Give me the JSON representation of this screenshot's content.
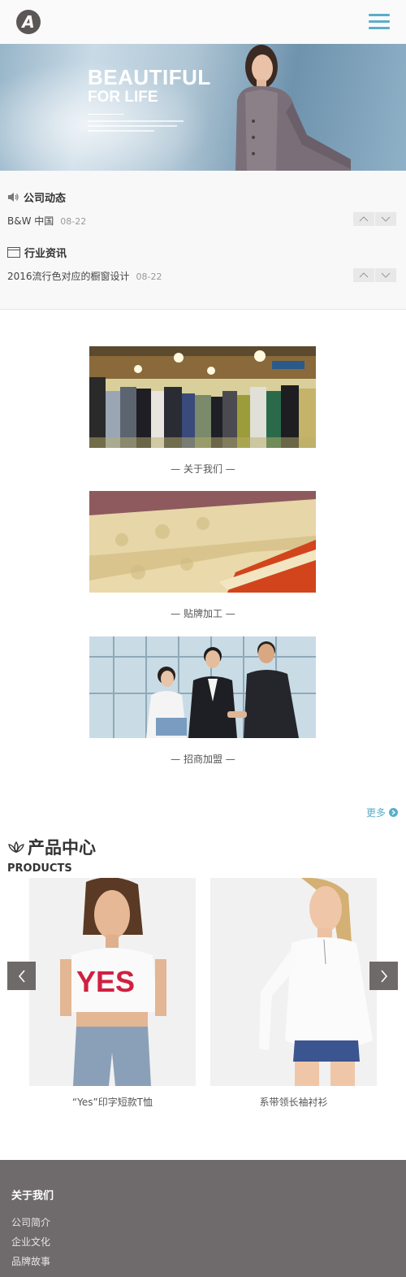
{
  "header": {
    "logo_letter": "A"
  },
  "banner": {
    "title": "BEAUTIFUL",
    "subtitle": "FOR LIFE",
    "slide_count": 2,
    "active_slide": 1,
    "colors": {
      "active_dot": "#1f7fe0",
      "inactive_dot": "#9aa9b6"
    }
  },
  "news": [
    {
      "heading": "公司动态",
      "item": "B&W 中国",
      "date": "08-22",
      "icon": "speaker-icon"
    },
    {
      "heading": "行业资讯",
      "item": "2016流行色对应的橱窗设计",
      "date": "08-22",
      "icon": "window-icon"
    }
  ],
  "features": [
    {
      "caption": "— 关于我们 —"
    },
    {
      "caption": "— 贴牌加工 —"
    },
    {
      "caption": "— 招商加盟 —"
    }
  ],
  "products": {
    "more_label": "更多",
    "title": "产品中心",
    "subtitle": "PRODUCTS",
    "items": [
      {
        "name": "“Yes”印字短款T恤"
      },
      {
        "name": "系带领长袖衬衫"
      }
    ]
  },
  "footer": {
    "title": "关于我们",
    "links": [
      "公司简介",
      "企业文化",
      "品牌故事"
    ]
  },
  "colors": {
    "accent": "#5aaec8",
    "footer_bg": "#6f6a6b"
  }
}
